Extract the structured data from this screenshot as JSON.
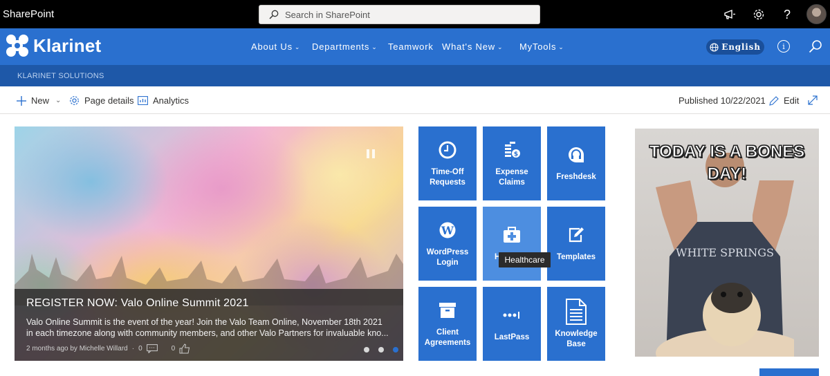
{
  "suite": {
    "app_name": "SharePoint",
    "search_placeholder": "Search in SharePoint",
    "icons": [
      "megaphone-icon",
      "gear-icon",
      "help-icon",
      "avatar"
    ]
  },
  "hub": {
    "brand": "Klarinet",
    "nav": [
      {
        "label": "About Us",
        "has_dropdown": true
      },
      {
        "label": "Departments",
        "has_dropdown": true
      },
      {
        "label": "Teamwork",
        "has_dropdown": false
      },
      {
        "label": "What's New",
        "has_dropdown": true
      },
      {
        "label": "MyTools",
        "has_dropdown": true
      }
    ],
    "language": "English",
    "accent": "#2a70cf"
  },
  "site": {
    "title": "KLARINET SOLUTIONS"
  },
  "commandbar": {
    "new_label": "New",
    "page_details_label": "Page details",
    "analytics_label": "Analytics",
    "published": "Published 10/22/2021",
    "edit_label": "Edit"
  },
  "hero": {
    "headline": "REGISTER NOW: Valo Online Summit 2021",
    "excerpt": "Valo Online Summit is the event of the year! Join the Valo Team Online, November 18th 2021 in each timezone along with community members, and other Valo Partners for invaluable kno...",
    "meta": "2 months ago by Michelle Willard",
    "comments": "0",
    "likes": "0",
    "slide_count": 3,
    "active_slide": 3
  },
  "tiles": [
    {
      "label": "Time-Off Requests",
      "icon": "clock-icon"
    },
    {
      "label": "Expense Claims",
      "icon": "coins-icon"
    },
    {
      "label": "Freshdesk",
      "icon": "headset-icon"
    },
    {
      "label": "WordPress Login",
      "icon": "wordpress-icon"
    },
    {
      "label": "Healthcare",
      "icon": "medical-kit-icon",
      "hovered": true,
      "visible_label": "H"
    },
    {
      "label": "Templates",
      "icon": "edit-icon"
    },
    {
      "label": "Client Agreements",
      "icon": "archive-box-icon"
    },
    {
      "label": "LastPass",
      "icon": "lastpass-icon"
    },
    {
      "label": "Knowledge Base",
      "icon": "document-icon"
    }
  ],
  "tooltip": "Healthcare",
  "meme": {
    "caption": "TODAY IS A BONES DAY!"
  }
}
